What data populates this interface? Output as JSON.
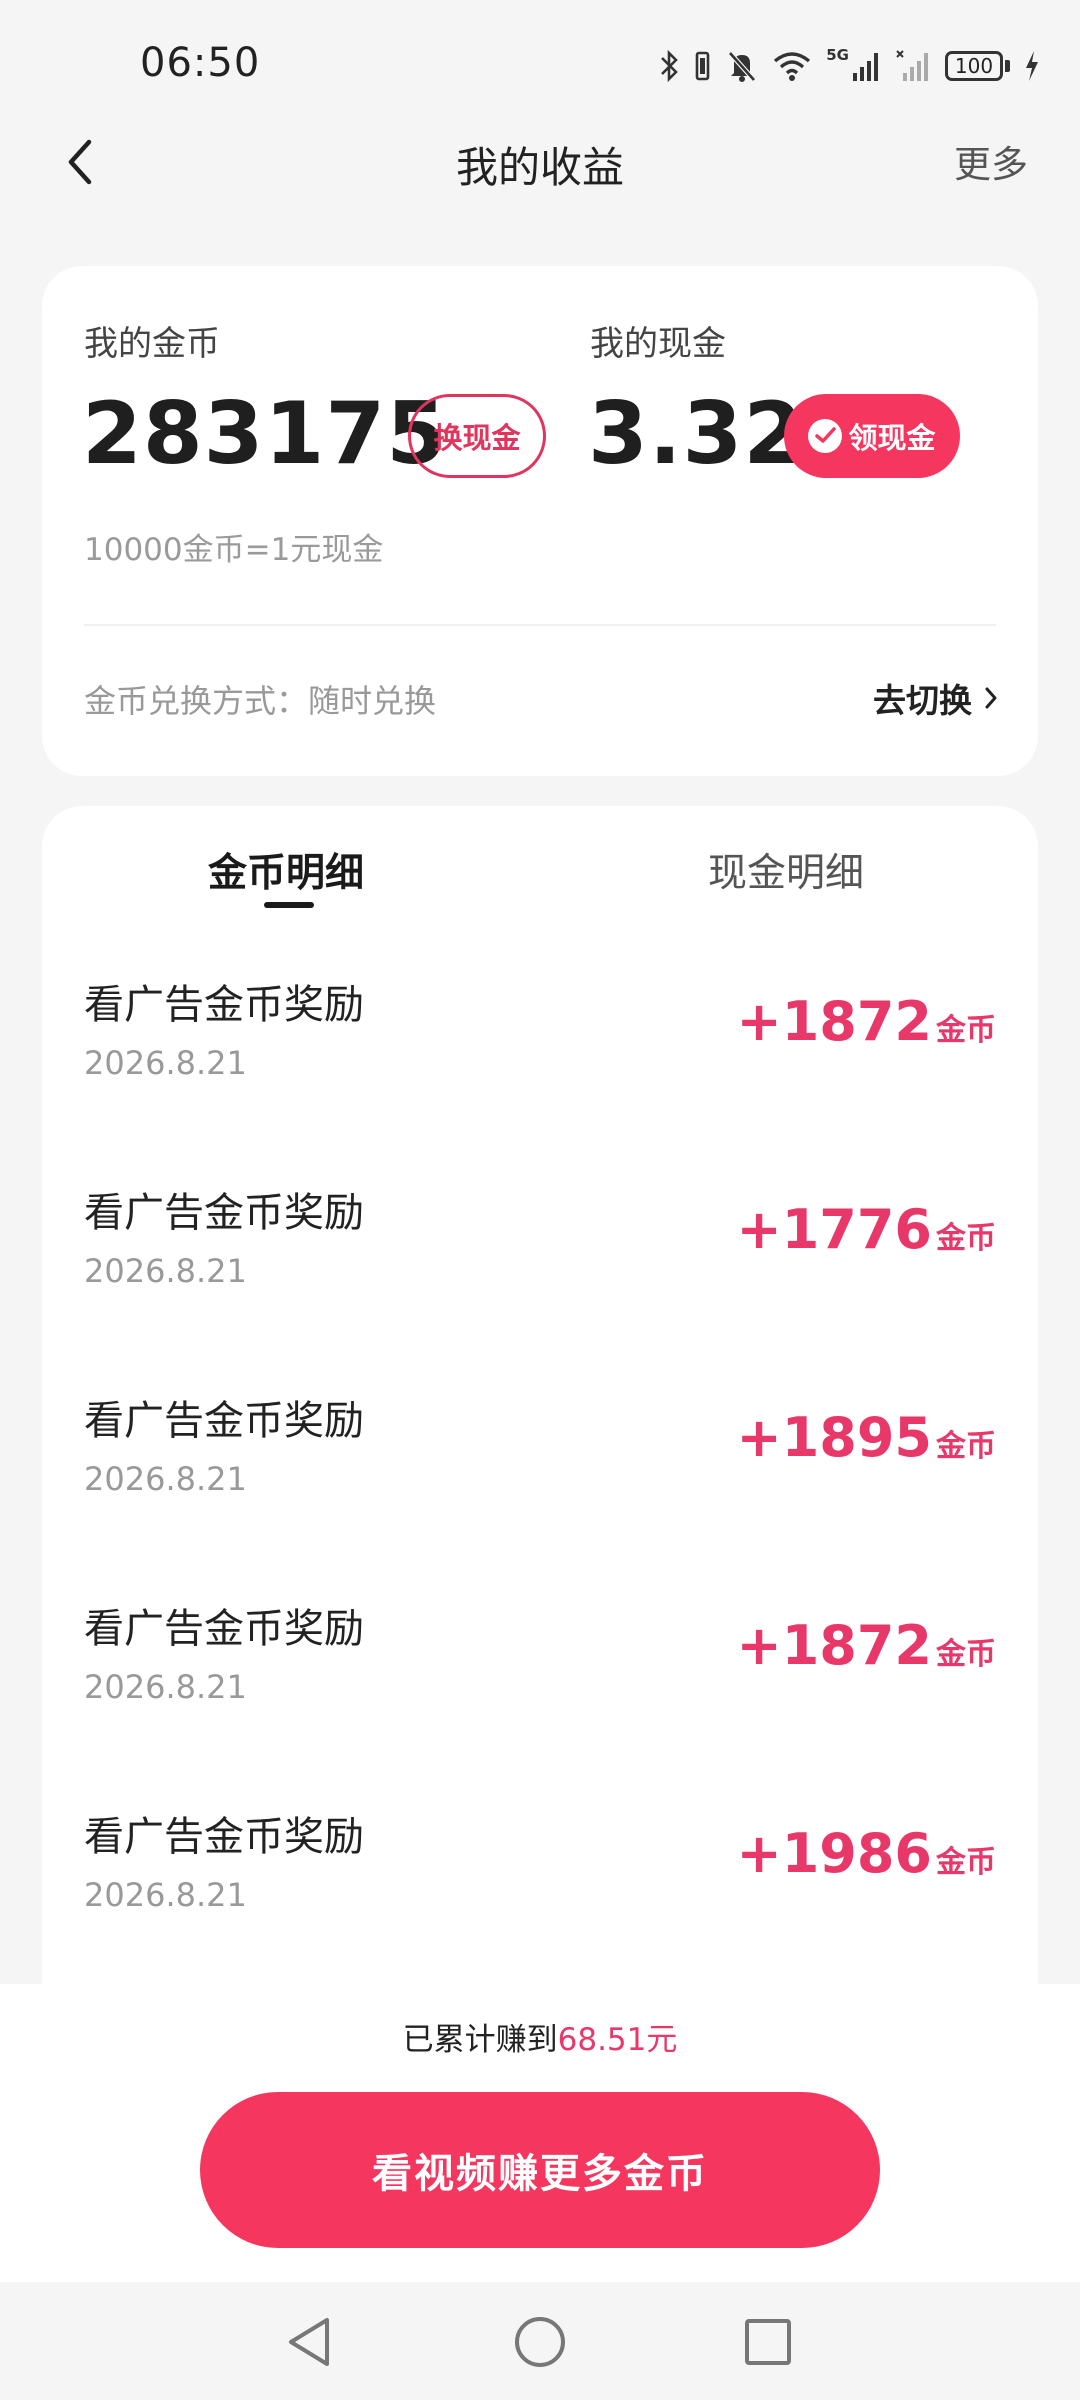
{
  "status_bar": {
    "time": "06:50",
    "network": "5G",
    "battery": "100",
    "icons": [
      "bluetooth-icon",
      "vibrate-icon",
      "mute-icon",
      "wifi-icon",
      "signal-icon",
      "signal-icon",
      "charging-icon"
    ]
  },
  "header": {
    "title": "我的收益",
    "more_label": "更多",
    "back_icon": "chevron-left-icon"
  },
  "balance": {
    "coin_label": "我的金币",
    "coin_value": "283175",
    "exchange_label": "换现金",
    "cash_label": "我的现金",
    "cash_value": "3.32",
    "withdraw_label": "领现金",
    "withdraw_icon": "wechat-icon",
    "rate_text": "10000金币=1元现金",
    "method_text": "金币兑换方式：随时兑换",
    "switch_label": "去切换"
  },
  "tabs": {
    "coin_tab": "金币明细",
    "cash_tab": "现金明细"
  },
  "records": [
    {
      "title": "看广告金币奖励",
      "date": "2026.8.21",
      "amount": "+1872",
      "unit": "金币"
    },
    {
      "title": "看广告金币奖励",
      "date": "2026.8.21",
      "amount": "+1776",
      "unit": "金币"
    },
    {
      "title": "看广告金币奖励",
      "date": "2026.8.21",
      "amount": "+1895",
      "unit": "金币"
    },
    {
      "title": "看广告金币奖励",
      "date": "2026.8.21",
      "amount": "+1872",
      "unit": "金币"
    },
    {
      "title": "看广告金币奖励",
      "date": "2026.8.21",
      "amount": "+1986",
      "unit": "金币"
    }
  ],
  "footer": {
    "total_prefix": "已累计赚到",
    "total_amount": "68.51元",
    "cta_label": "看视频赚更多金币"
  },
  "colors": {
    "accent": "#f5365f",
    "amount": "#e8386a",
    "background": "#f5f5f5"
  }
}
